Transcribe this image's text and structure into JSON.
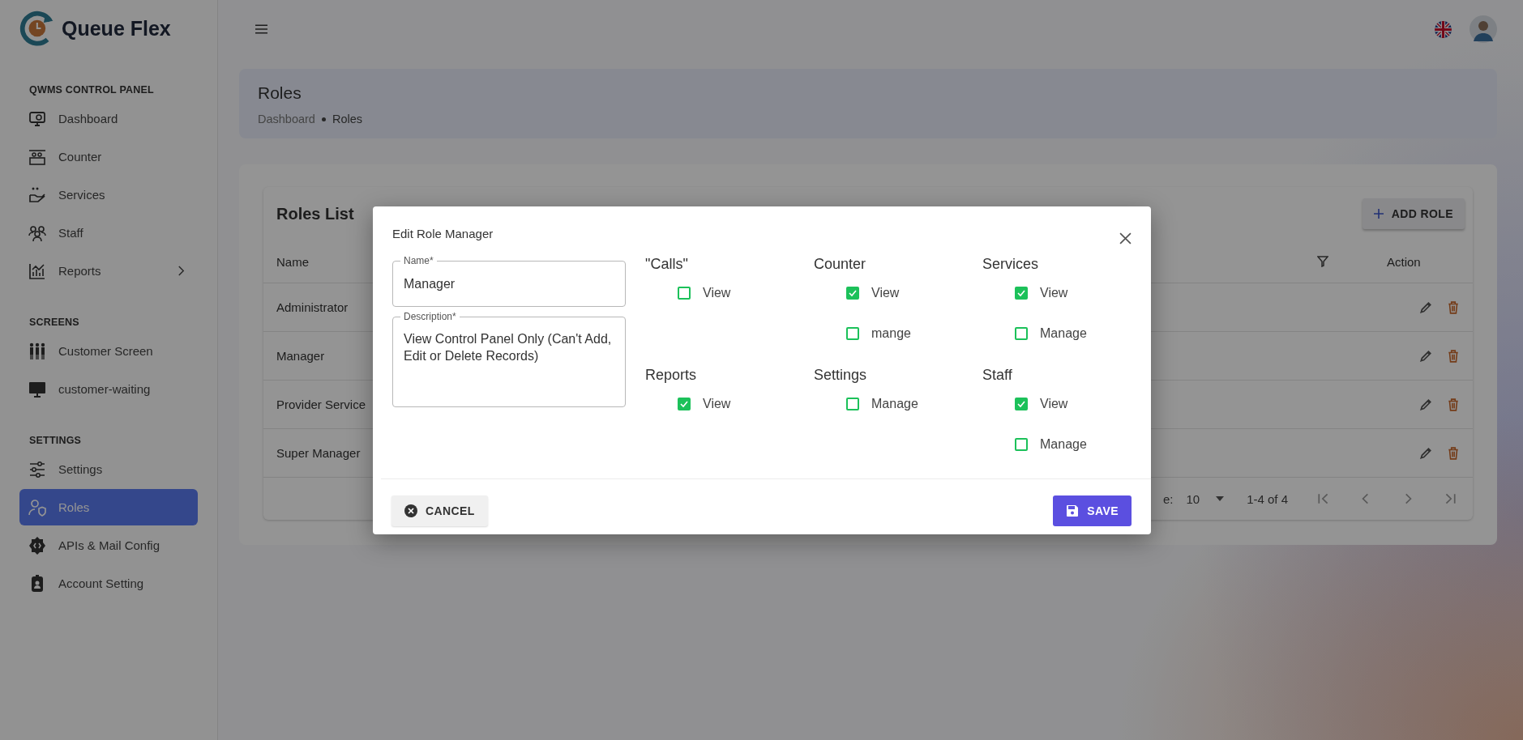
{
  "brand": {
    "name": "Queue Flex"
  },
  "sidebar": {
    "sections": [
      {
        "title": "QWMS CONTROL PANEL",
        "items": [
          {
            "label": "Dashboard",
            "kind": "link",
            "selected": false
          },
          {
            "label": "Counter",
            "kind": "link",
            "selected": false
          },
          {
            "label": "Services",
            "kind": "link",
            "selected": false
          },
          {
            "label": "Staff",
            "kind": "link",
            "selected": false
          },
          {
            "label": "Reports",
            "kind": "submenu",
            "selected": false
          }
        ]
      },
      {
        "title": "SCREENS",
        "items": [
          {
            "label": "Customer Screen",
            "kind": "link",
            "selected": false
          },
          {
            "label": "customer-waiting",
            "kind": "link",
            "selected": false
          }
        ]
      },
      {
        "title": "SETTINGS",
        "items": [
          {
            "label": "Settings",
            "kind": "link",
            "selected": false
          },
          {
            "label": "Roles",
            "kind": "link",
            "selected": true
          },
          {
            "label": "APIs & Mail Config",
            "kind": "link",
            "selected": false
          },
          {
            "label": "Account Setting",
            "kind": "link",
            "selected": false
          }
        ]
      }
    ]
  },
  "page_header": {
    "title": "Roles",
    "breadcrumb": [
      {
        "label": "Dashboard"
      },
      {
        "label": "Roles"
      }
    ]
  },
  "roles_card": {
    "title": "Roles List",
    "add_button": "ADD ROLE",
    "columns": [
      "Name",
      "Action"
    ],
    "rows": [
      {
        "name": "Administrator"
      },
      {
        "name": "Manager"
      },
      {
        "name": "Provider Service"
      },
      {
        "name": "Super Manager"
      }
    ],
    "pagination": {
      "rows_per_page_label": "e:",
      "rows_per_page": "10",
      "range": "1-4 of 4"
    }
  },
  "modal": {
    "title": "Edit Role Manager",
    "fields": [
      {
        "label": "Name*",
        "value": "Manager",
        "kind": "input"
      },
      {
        "label": "Description*",
        "value": "View Control Panel Only (Can't Add, Edit or Delete Records)",
        "kind": "textarea"
      }
    ],
    "groups": [
      {
        "title": "\"Calls\"",
        "options": [
          {
            "label": "View",
            "checked": false
          }
        ]
      },
      {
        "title": "Counter",
        "options": [
          {
            "label": "View",
            "checked": true
          },
          {
            "label": "mange",
            "checked": false
          }
        ]
      },
      {
        "title": "Services",
        "options": [
          {
            "label": "View",
            "checked": true
          },
          {
            "label": "Manage",
            "checked": false
          }
        ]
      },
      {
        "title": "Reports",
        "options": [
          {
            "label": "View",
            "checked": true
          }
        ]
      },
      {
        "title": "Settings",
        "options": [
          {
            "label": "Manage",
            "checked": false
          }
        ]
      },
      {
        "title": "Staff",
        "options": [
          {
            "label": "View",
            "checked": true
          },
          {
            "label": "Manage",
            "checked": false
          }
        ]
      }
    ],
    "cancel_button": "CANCEL",
    "save_button": "SAVE"
  }
}
